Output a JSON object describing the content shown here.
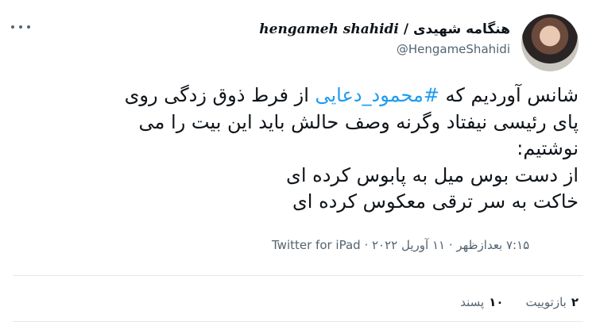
{
  "author": {
    "name_latin": "hengameh shahidi",
    "name_separator": "/",
    "name_persian": "هنگامه شهیدی",
    "handle": "@HengameShahidi"
  },
  "tweet": {
    "line1_before": "شانس آوردیم که ",
    "hashtag": "#محمود_دعایی",
    "line1_after": " از فرط ذوق زدگی روی",
    "line2": "پای رئیسی نیفتاد وگرنه وصف حالش باید این بیت را می",
    "line3": "نوشتیم:",
    "line4": "از دست بوس میل به پابوس کرده ای",
    "line5": "خاکت به سر ترقی معکوس کرده ای"
  },
  "meta": {
    "time": "۷:۱۵ بعدازظهر",
    "separator1": " · ",
    "date": "۱۱ آوریل ۲۰۲۲",
    "separator2": " · ",
    "source": "Twitter for iPad"
  },
  "stats": {
    "retweets_count": "۲",
    "retweets_label": "بازتوییت",
    "likes_count": "۱۰",
    "likes_label": "پسند"
  },
  "colors": {
    "accent": "#1d9bf0",
    "text": "#0f1419",
    "muted": "#536471"
  },
  "icons": {
    "more": "more-horizontal-icon"
  }
}
